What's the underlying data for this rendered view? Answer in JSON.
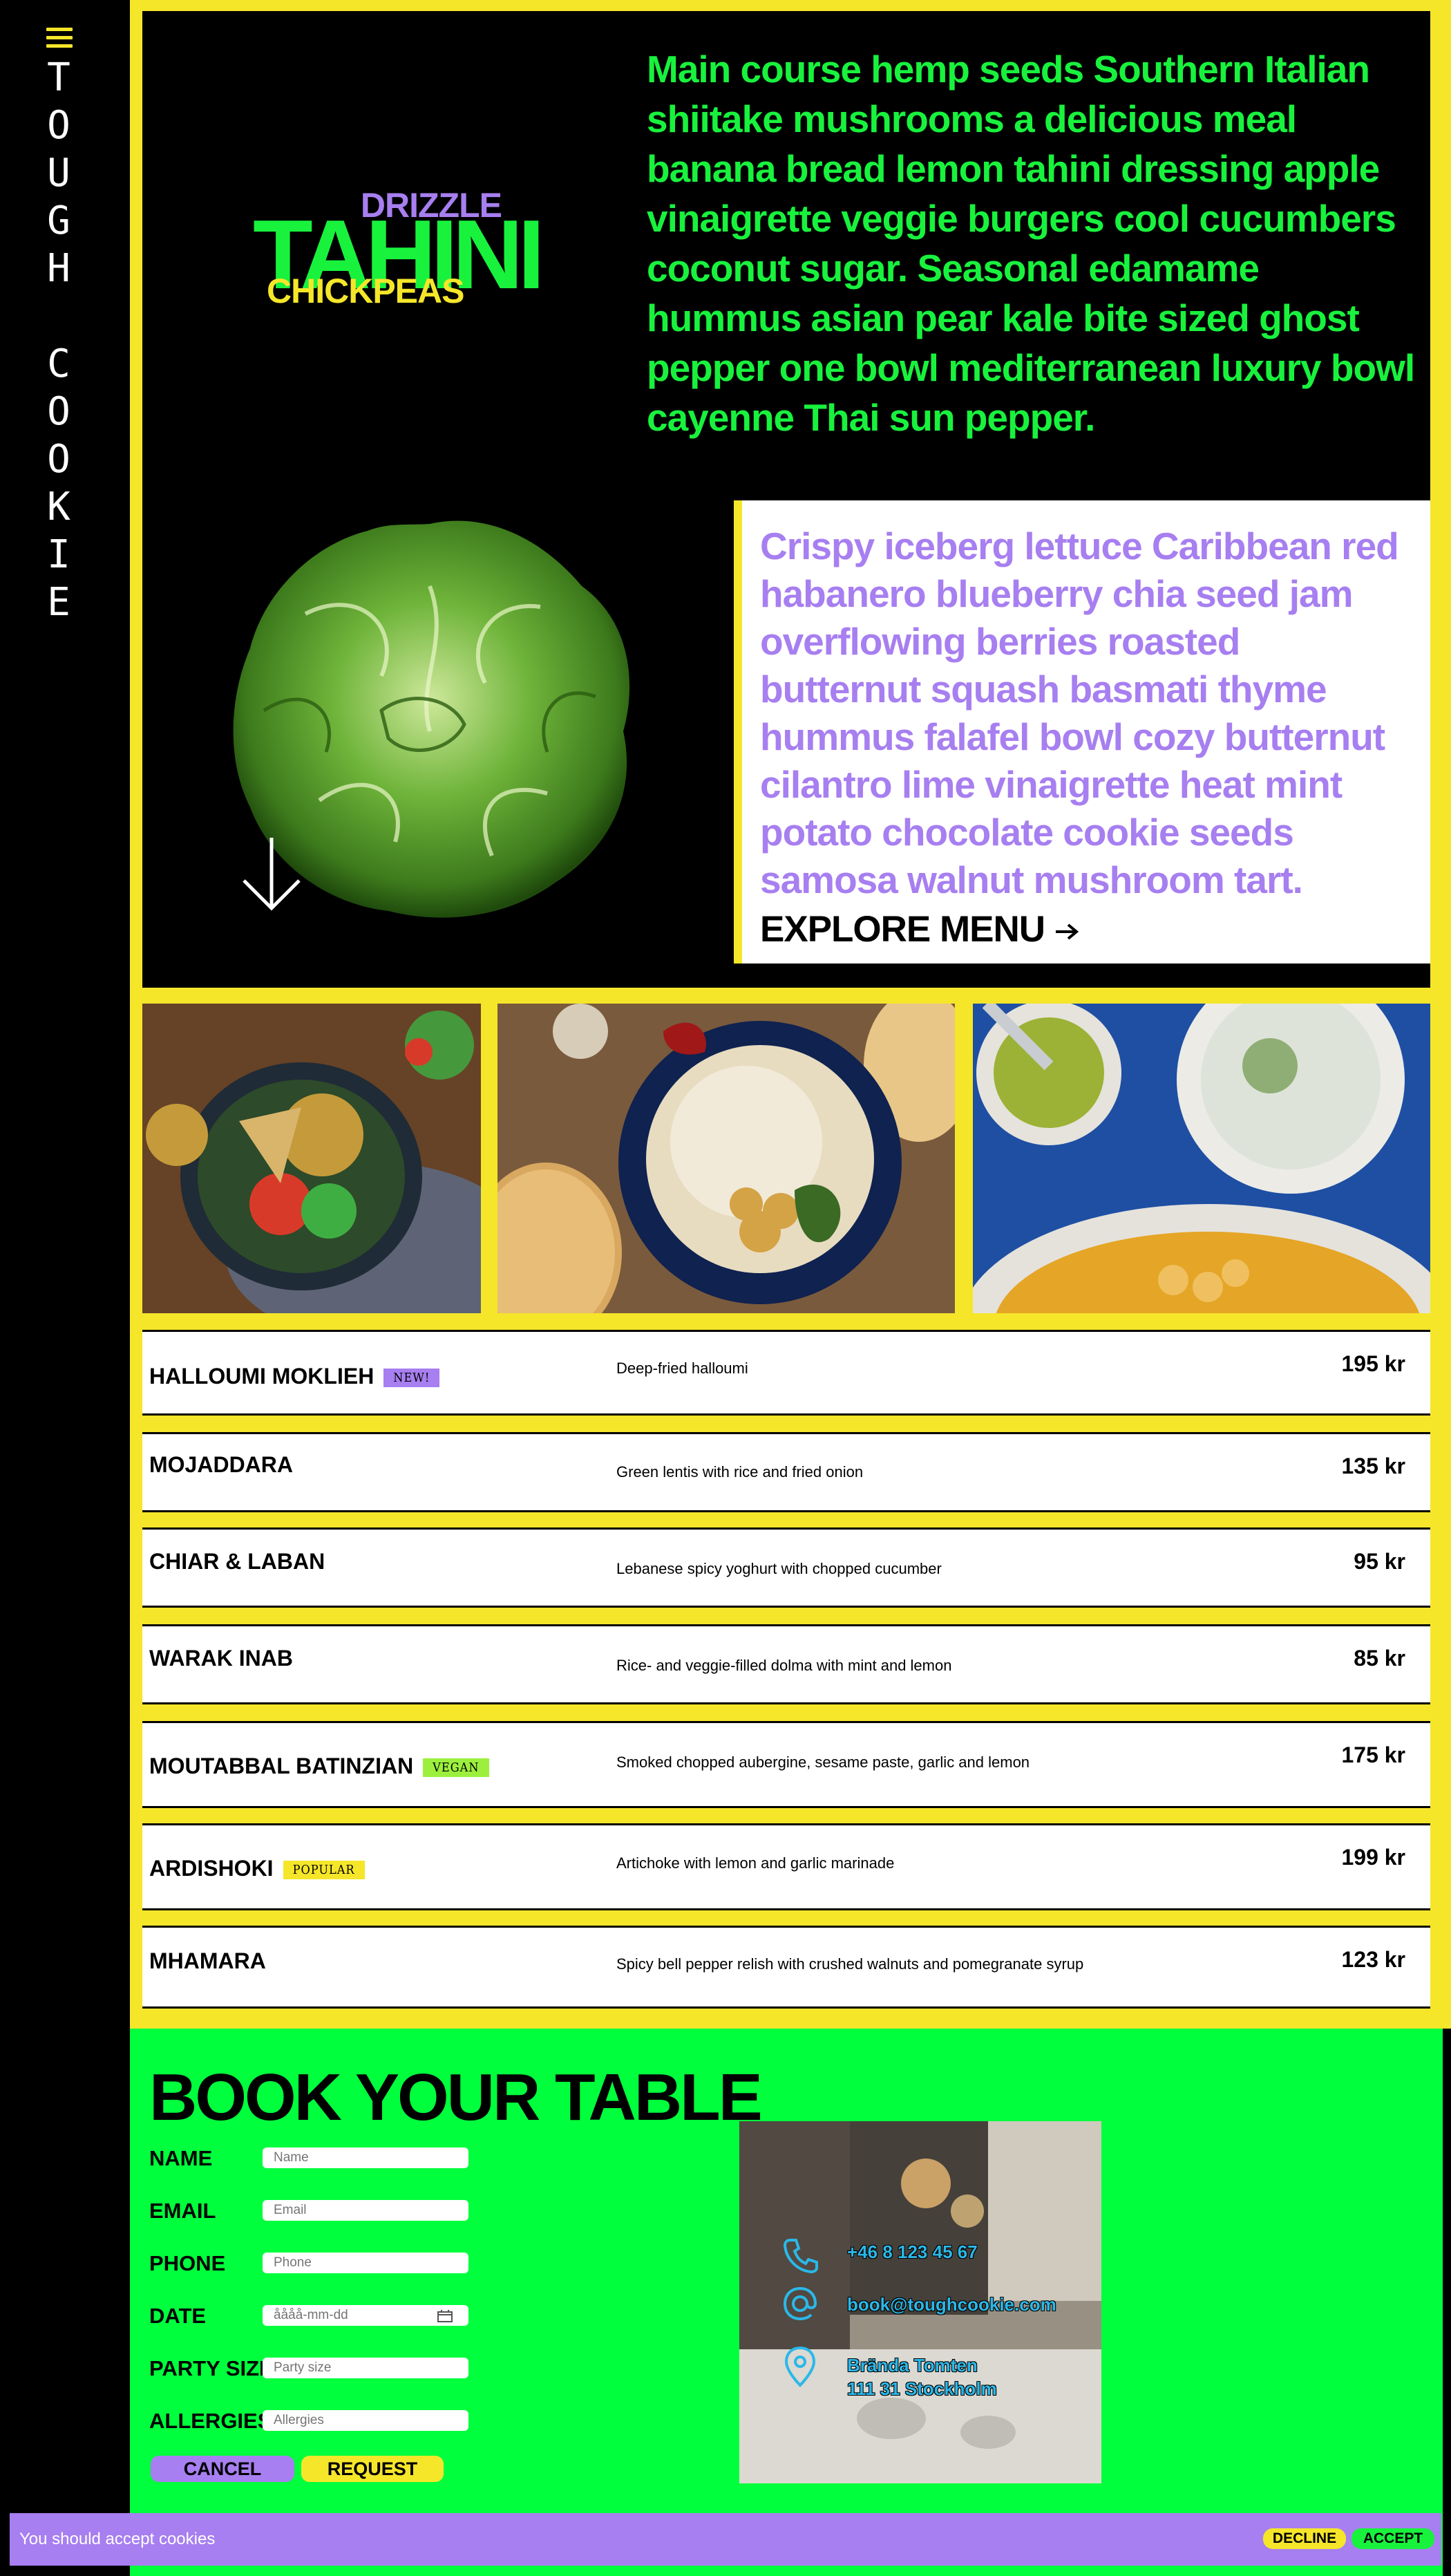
{
  "sidebar": {
    "logo_letters": [
      "T",
      "O",
      "U",
      "G",
      "H",
      " ",
      "C",
      "O",
      "O",
      "K",
      "I",
      "E"
    ],
    "menu_icon": "hamburger-icon"
  },
  "hero": {
    "logo": {
      "top": "DRIZZLE",
      "main": "TAHINI",
      "bottom": "CHICKPEAS"
    },
    "intro": "Main course hemp seeds Southern Italian shiitake mushrooms a delicious meal banana bread lemon tahini dressing apple vinaigrette veggie burgers cool cucumbers coconut sugar. Seasonal edamame hummus asian pear kale bite sized ghost pepper one bowl mediterranean luxury bowl cayenne Thai sun pepper.",
    "feature": "Crispy iceberg lettuce Caribbean red habanero blueberry chia seed jam overflowing berries roasted butternut squash basmati thyme hummus falafel bowl cozy butternut cilantro lime vinaigrette heat mint potato chocolate cookie seeds samosa walnut mushroom tart.",
    "explore_label": "EXPLORE MENU",
    "explore_icon": "arrow-right-icon",
    "scroll_icon": "arrow-down-icon"
  },
  "menu": [
    {
      "name": "HALLOUMI MOKLIEH",
      "tag": "NEW!",
      "tag_color": "#a77ff0",
      "desc": "Deep-fried halloumi",
      "price": "195 kr"
    },
    {
      "name": "MOJADDARA",
      "tag": "",
      "desc": "Green lentis with rice and fried onion",
      "price": "135 kr"
    },
    {
      "name": "CHIAR & LABAN",
      "tag": "",
      "desc": "Lebanese spicy yoghurt with chopped cucumber",
      "price": "95 kr"
    },
    {
      "name": "WARAK INAB",
      "tag": "",
      "desc": "Rice- and veggie-filled dolma with mint and lemon",
      "price": "85 kr"
    },
    {
      "name": "MOUTABBAL BATINZIAN",
      "tag": "VEGAN",
      "tag_color": "#9cf03d",
      "desc": "Smoked chopped aubergine, sesame paste, garlic and lemon",
      "price": "175 kr"
    },
    {
      "name": "ARDISHOKI",
      "tag": "POPULAR",
      "tag_color": "#f5e62a",
      "desc": "Artichoke with lemon and garlic marinade",
      "price": "199 kr"
    },
    {
      "name": "MHAMARA",
      "tag": "",
      "desc": "Spicy bell pepper relish with crushed walnuts and pomegranate syrup",
      "price": "123 kr"
    }
  ],
  "booking": {
    "title": "BOOK YOUR TABLE",
    "fields": [
      {
        "label": "NAME",
        "placeholder": "Name"
      },
      {
        "label": "EMAIL",
        "placeholder": "Email"
      },
      {
        "label": "PHONE",
        "placeholder": "Phone"
      },
      {
        "label": "DATE",
        "placeholder": "åååå-mm-dd"
      },
      {
        "label": "PARTY SIZE",
        "placeholder": "Party size"
      },
      {
        "label": "ALLERGIES",
        "placeholder": "Allergies"
      }
    ],
    "cancel_label": "CANCEL",
    "request_label": "REQUEST",
    "contact": {
      "phone": "+46 8 123 45 67",
      "email": "book@toughcookie.com",
      "address_line1": "Brända Tomten",
      "address_line2": "111 31 Stockholm"
    }
  },
  "cookie_bar": {
    "text": "You should accept cookies",
    "decline_label": "DECLINE",
    "accept_label": "ACCEPT"
  },
  "colors": {
    "yellow": "#f5e62a",
    "green": "#18f23d",
    "booking_green": "#00ff3c",
    "purple": "#a77ff0",
    "black": "#000000"
  }
}
